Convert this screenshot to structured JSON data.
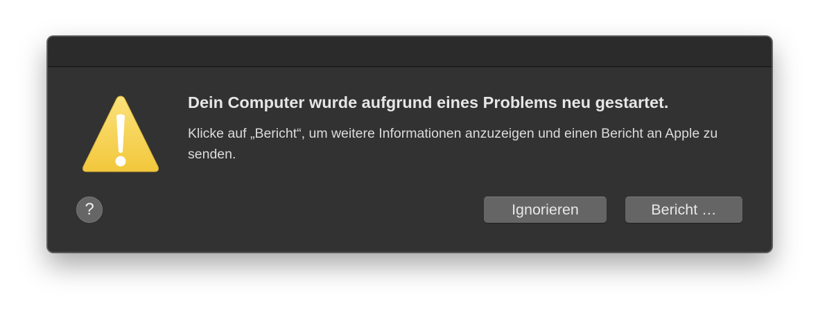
{
  "dialog": {
    "headline": "Dein Computer wurde aufgrund eines Problems neu gestartet.",
    "message": "Klicke auf „Bericht“, um weitere Informationen anzuzeigen und einen Bericht an Apple zu senden.",
    "help_label": "?",
    "buttons": {
      "ignore_label": "Ignorieren",
      "report_label": "Bericht …"
    },
    "icon": "warning-triangle",
    "colors": {
      "background": "#323232",
      "button": "#656565",
      "warning_yellow": "#f7d44f"
    }
  }
}
